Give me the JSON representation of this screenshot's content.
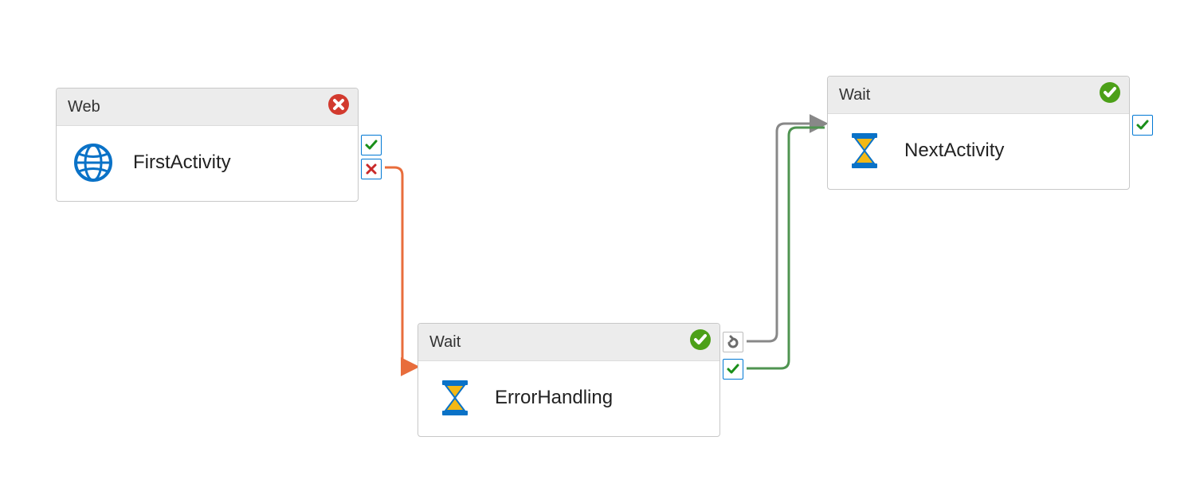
{
  "nodes": {
    "first": {
      "type_label": "Web",
      "title": "FirstActivity",
      "status": "error",
      "icon": "web-globe-icon",
      "ports": {
        "success": true,
        "failure": true
      }
    },
    "error": {
      "type_label": "Wait",
      "title": "ErrorHandling",
      "status": "success",
      "icon": "hourglass-icon",
      "ports": {
        "completion": true,
        "success": true
      }
    },
    "next": {
      "type_label": "Wait",
      "title": "NextActivity",
      "status": "success",
      "icon": "hourglass-icon",
      "ports": {
        "success": true
      }
    }
  },
  "connectors": [
    {
      "from": "first.failure",
      "to": "error",
      "color": "#e86d3c",
      "kind": "failure"
    },
    {
      "from": "error.completion",
      "to": "next",
      "color": "#888888",
      "kind": "completion"
    },
    {
      "from": "error.success",
      "to": "next",
      "color": "#4f9451",
      "kind": "success"
    }
  ],
  "colors": {
    "error_badge": "#d23a2e",
    "success_badge": "#4ca018",
    "port_border": "#0078d4",
    "check_green": "#1a8f1a",
    "x_red": "#c92a2a",
    "failure_line": "#e86d3c",
    "success_line": "#4f9451",
    "completion_line": "#888888"
  }
}
